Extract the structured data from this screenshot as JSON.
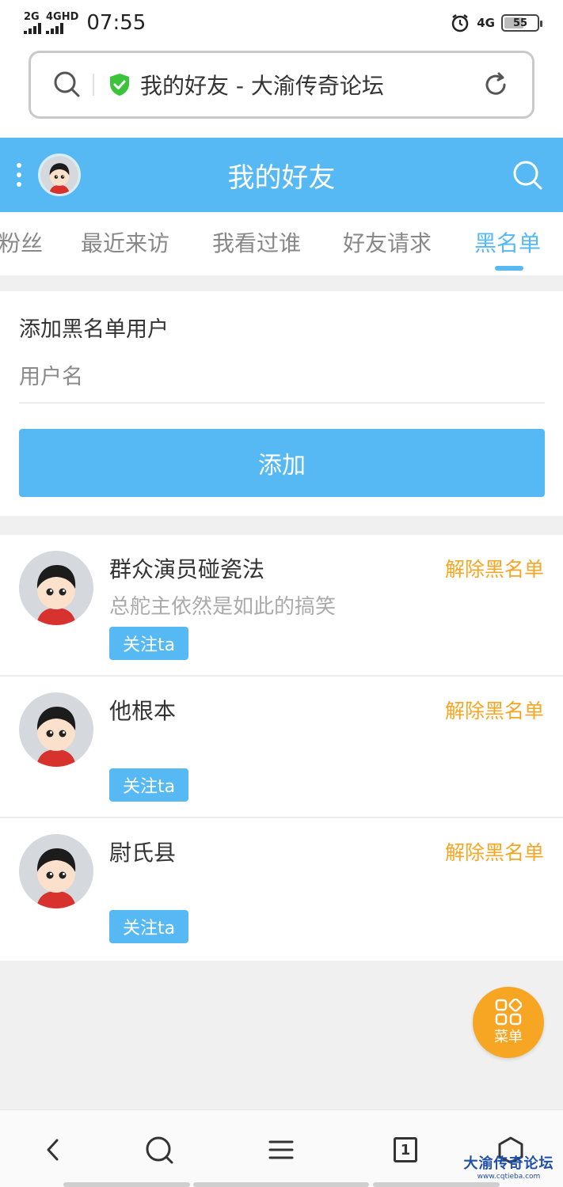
{
  "status_bar": {
    "signal_1": "2G",
    "signal_2": "4GHD",
    "time": "07:55",
    "net": "4G",
    "battery": "55"
  },
  "address_bar": {
    "title": "我的好友 - 大渝传奇论坛"
  },
  "header": {
    "title": "我的好友"
  },
  "tabs": [
    {
      "label": "粉丝"
    },
    {
      "label": "最近来访"
    },
    {
      "label": "我看过谁"
    },
    {
      "label": "好友请求"
    },
    {
      "label": "黑名单",
      "active": true
    }
  ],
  "add_form": {
    "title": "添加黑名单用户",
    "placeholder": "用户名",
    "button": "添加"
  },
  "blacklist": [
    {
      "name": "群众演员碰瓷法",
      "signature": "总舵主依然是如此的搞笑",
      "action": "解除黑名单",
      "follow": "关注ta"
    },
    {
      "name": "他根本",
      "signature": "",
      "action": "解除黑名单",
      "follow": "关注ta"
    },
    {
      "name": "尉氏县",
      "signature": "",
      "action": "解除黑名单",
      "follow": "关注ta"
    }
  ],
  "fab": {
    "label": "菜单"
  },
  "bottom_nav": {
    "tab_count": "1"
  },
  "watermark": {
    "title": "大渝传奇论坛",
    "url": "www.cqtieba.com"
  },
  "colors": {
    "accent": "#56b9f4",
    "action": "#f5a623",
    "fab": "#f6a623"
  }
}
